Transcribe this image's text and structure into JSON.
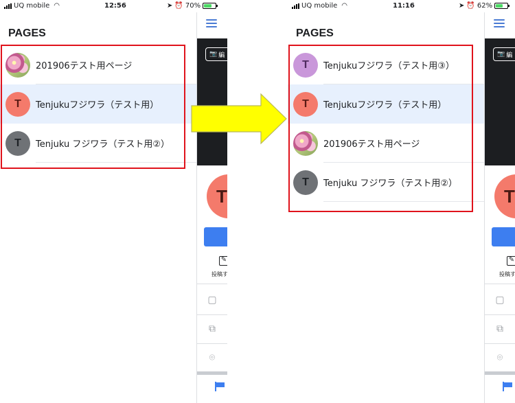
{
  "left": {
    "status": {
      "carrier": "UQ mobile",
      "time": "12:56",
      "battery": "70%",
      "battery_level": 0.7
    },
    "title": "PAGES",
    "items": [
      {
        "label": "201906テスト用ページ",
        "avatar": "",
        "avatar_style": "flower"
      },
      {
        "label": "Tenjukuフジワラ（テスト用）",
        "avatar": "T",
        "avatar_style": "red",
        "active": true
      },
      {
        "label": "Tenjuku フジワラ（テスト用②）",
        "avatar": "T",
        "avatar_style": "gray"
      }
    ]
  },
  "right": {
    "status": {
      "carrier": "UQ mobile",
      "time": "11:16",
      "battery": "62%",
      "battery_level": 0.62
    },
    "title": "PAGES",
    "items": [
      {
        "label": "Tenjukuフジワラ（テスト用③）",
        "avatar": "T",
        "avatar_style": "purple"
      },
      {
        "label": "Tenjukuフジワラ（テスト用）",
        "avatar": "T",
        "avatar_style": "red",
        "active": true
      },
      {
        "label": "201906テスト用ページ",
        "avatar": "",
        "avatar_style": "flower"
      },
      {
        "label": "Tenjuku フジワラ（テスト用②）",
        "avatar": "T",
        "avatar_style": "gray"
      }
    ]
  },
  "side_panel": {
    "cover_button_label": "編",
    "profile_initial": "T",
    "post_label": "投稿す",
    "icons": [
      "menu-icon",
      "camera-icon",
      "pencil-icon",
      "photo-icon",
      "copy-icon",
      "location-icon",
      "flag-icon"
    ]
  },
  "colors": {
    "highlight_border": "#e0121b",
    "arrow_fill": "#ffff00",
    "active_row": "#e7f0fd",
    "accent_blue": "#3d7ef0"
  }
}
